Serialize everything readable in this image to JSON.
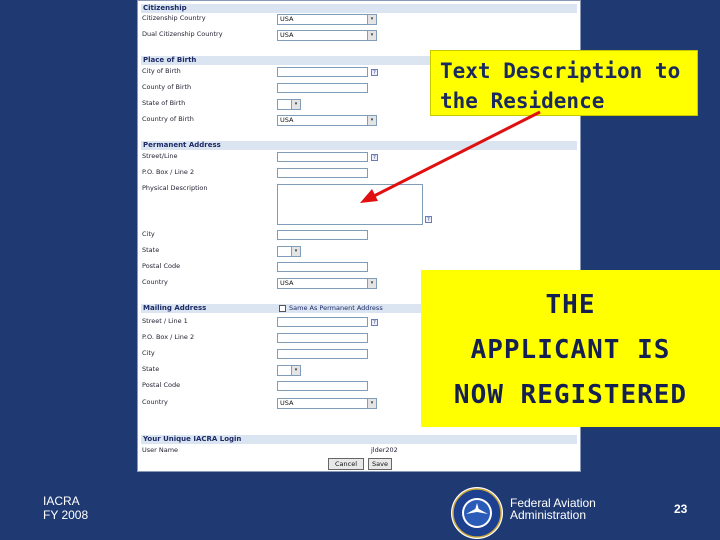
{
  "form": {
    "sections": {
      "citizenship": "Citizenship",
      "place_of_birth": "Place of Birth",
      "permanent_address": "Permanent Address",
      "mailing_address": "Mailing Address",
      "login": "Your Unique IACRA Login"
    },
    "labels": {
      "citizenship_country": "Citizenship Country",
      "dual_citizenship_country": "Dual Citizenship Country",
      "city_of_birth": "City of Birth",
      "county_of_birth": "County of Birth",
      "state_of_birth": "State of Birth",
      "country_of_birth": "Country of Birth",
      "perm_street": "Street/Line",
      "perm_po_box": "P.O. Box / Line 2",
      "perm_physical_description": "Physical Description",
      "perm_city": "City",
      "perm_state": "State",
      "perm_postal_code": "Postal Code",
      "perm_country": "Country",
      "mail_street": "Street / Line 1",
      "mail_po_box": "P.O. Box / Line 2",
      "mail_city": "City",
      "mail_state": "State",
      "mail_postal_code": "Postal Code",
      "mail_country": "Country",
      "user_name": "User Name"
    },
    "values": {
      "citizenship_country": "USA",
      "dual_citizenship_country": "USA",
      "country_of_birth": "USA",
      "perm_country": "USA",
      "mail_country": "USA",
      "user_name": "jlder202"
    },
    "same_as_permanent": "Same As Permanent Address",
    "buttons": {
      "cancel": "Cancel",
      "save": "Save"
    },
    "help_glyph": "?",
    "dropdown_glyph": "▾"
  },
  "callouts": {
    "residence": [
      "Text Description to",
      "the Residence"
    ],
    "registered": [
      "THE",
      "APPLICANT IS",
      "NOW REGISTERED"
    ]
  },
  "footer": {
    "org_lines": [
      "IACRA",
      "FY 2008"
    ],
    "agency_lines": [
      "Federal Aviation",
      "Administration"
    ],
    "page_number": "23"
  },
  "colors": {
    "background": "#1f3a73",
    "callout": "#ffff00",
    "arrow": "#e01010"
  }
}
